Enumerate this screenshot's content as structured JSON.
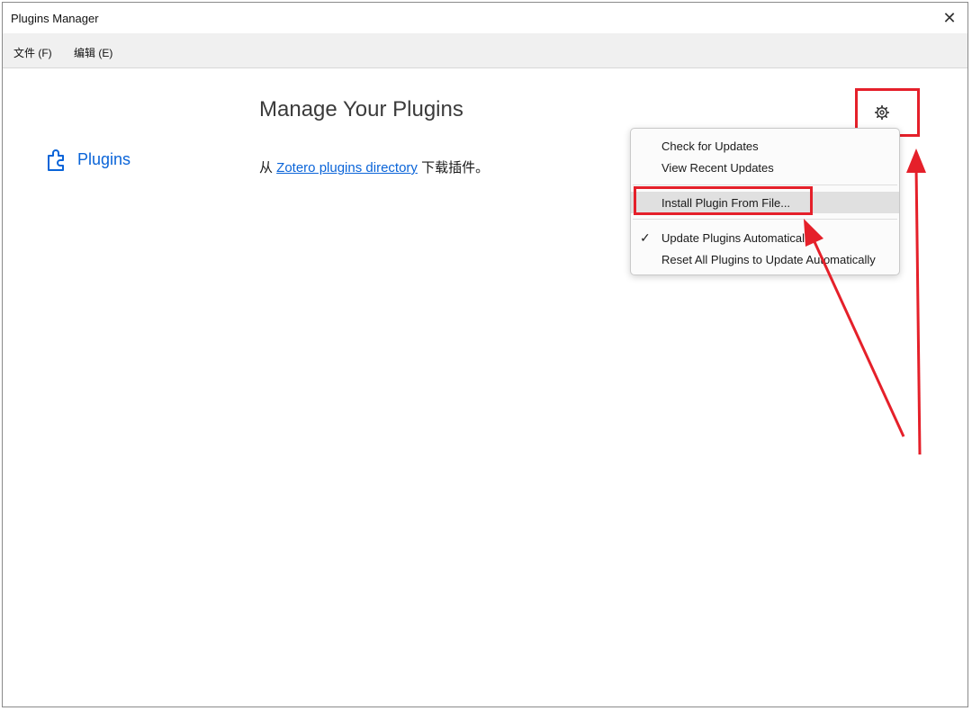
{
  "window": {
    "title": "Plugins Manager",
    "close_icon": "close-icon"
  },
  "menubar": {
    "file": "文件 (F)",
    "edit": "编辑 (E)"
  },
  "sidebar": {
    "plugins_label": "Plugins",
    "icon": "puzzle-piece-icon"
  },
  "main": {
    "title": "Manage Your Plugins",
    "desc_prefix": "从 ",
    "desc_link": "Zotero plugins directory",
    "desc_suffix": " 下载插件。"
  },
  "gear": {
    "icon": "gear-icon"
  },
  "popup_menu": {
    "items": [
      {
        "label": "Check for Updates"
      },
      {
        "label": "View Recent Updates"
      },
      {
        "label": "Install Plugin From File..."
      },
      {
        "label": "Update Plugins Automatically",
        "checked": true
      },
      {
        "label": "Reset All Plugins to Update Automatically"
      }
    ]
  },
  "colors": {
    "link": "#0a64d8",
    "annotation": "#e5202a"
  }
}
